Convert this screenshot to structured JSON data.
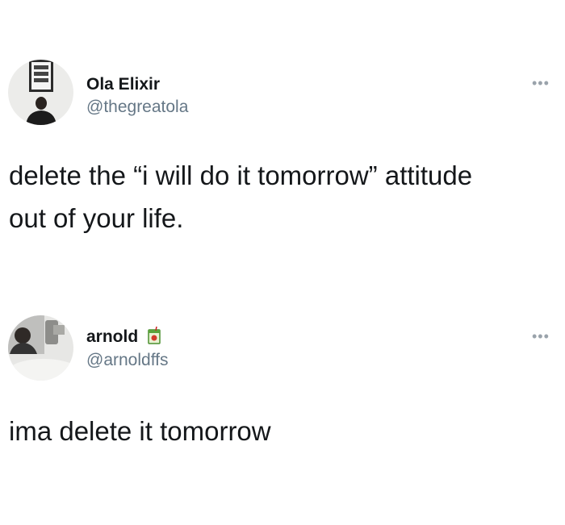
{
  "tweets": [
    {
      "author_name": "Ola Elixir",
      "handle": "@thegreatola",
      "text_lines": [
        "delete the “i will do it tomorrow” attitude",
        "out of your life."
      ],
      "more_icon": "ellipsis-icon",
      "avatar_icon": "profile-photo"
    },
    {
      "author_name": "arnold",
      "handle": "@arnoldffs",
      "name_emoji_icon": "juice-box-icon",
      "text_lines": [
        "ima delete it tomorrow"
      ],
      "more_icon": "ellipsis-icon",
      "avatar_icon": "profile-photo"
    }
  ],
  "more_glyph": "•••"
}
